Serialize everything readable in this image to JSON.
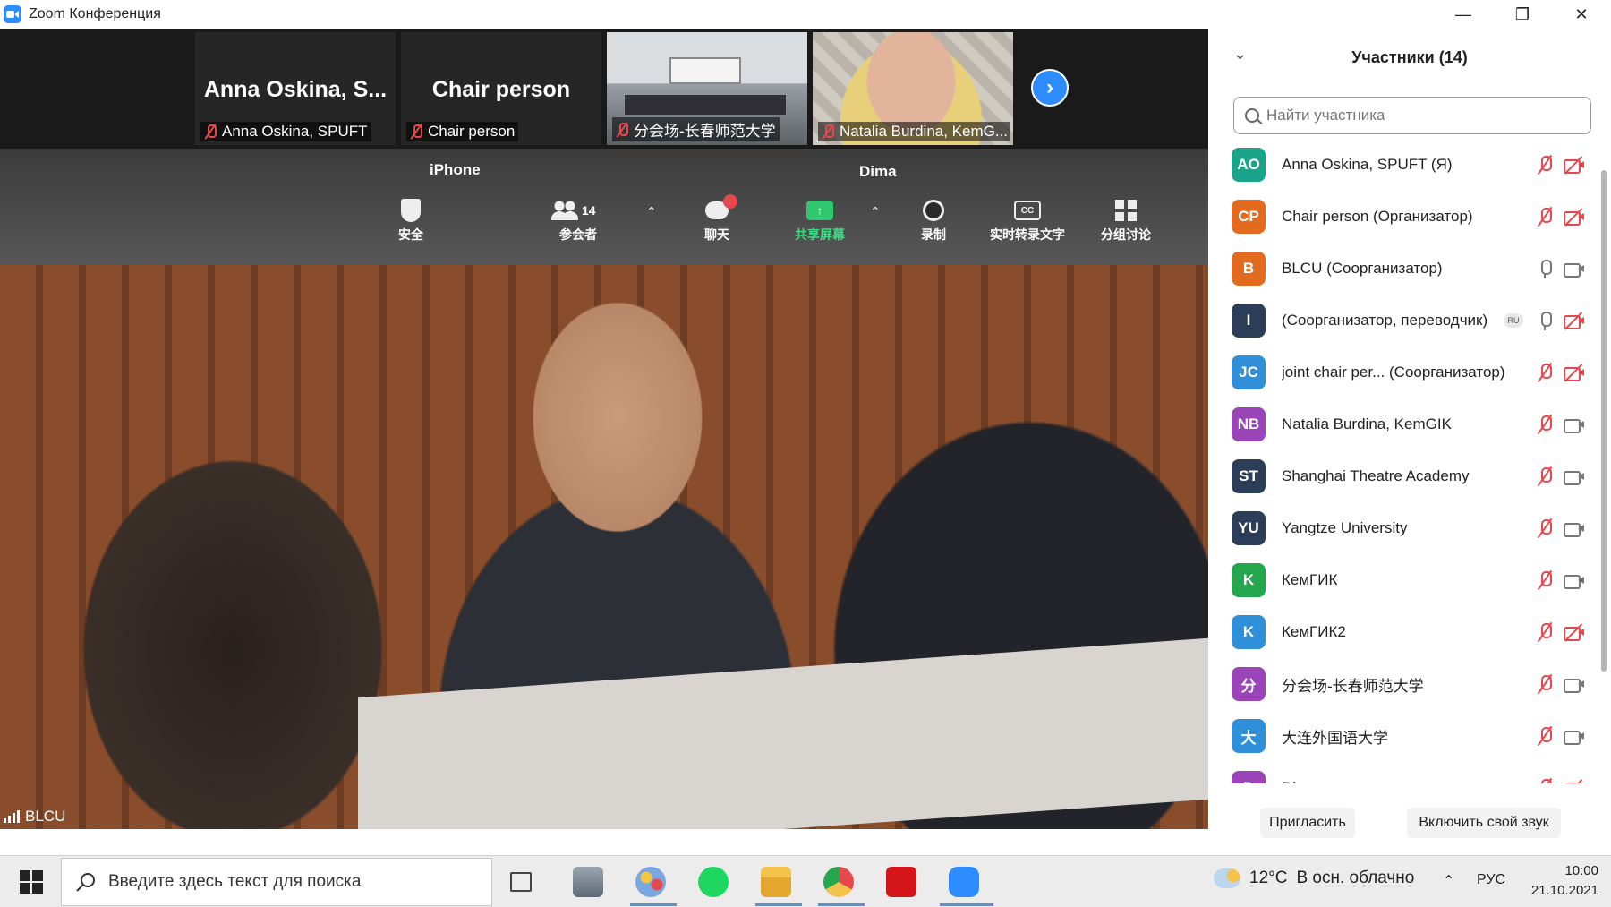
{
  "window": {
    "title": "Zoom Конференция",
    "minimize": "—",
    "restore": "❐",
    "close": "✕"
  },
  "strip": {
    "tiles": [
      {
        "big_name": "Anna  Oskina, S...",
        "label": "Anna Oskina, SPUFT"
      },
      {
        "big_name": "Chair person",
        "label": "Chair person"
      },
      {
        "big_name": "",
        "label": "分会场-长春师范大学"
      },
      {
        "big_name": "",
        "label": "Natalia Burdina, KemG..."
      }
    ],
    "next_icon": "chevron-right-icon"
  },
  "overlay": {
    "left_name": "iPhone",
    "right_name": "Dima"
  },
  "meeting_toolbar": {
    "security": "安全",
    "participants": "参会者",
    "participants_count": "14",
    "chat": "聊天",
    "share": "共享屏幕",
    "record": "录制",
    "captions": "实时转录文字",
    "breakout": "分组讨论",
    "cc": "CC"
  },
  "speaker": {
    "name": "BLCU"
  },
  "panel": {
    "title": "Участники (14)",
    "search_placeholder": "Найти участника",
    "participants": [
      {
        "initials": "AO",
        "name": "Anna Oskina, SPUFT (Я)",
        "color": "#1aa58a",
        "mic": "off",
        "cam": "off"
      },
      {
        "initials": "CP",
        "name": "Chair person (Организатор)",
        "color": "#e36b1f",
        "mic": "off",
        "cam": "off"
      },
      {
        "initials": "B",
        "name": "BLCU (Соорганизатор)",
        "color": "#e36b1f",
        "mic": "on",
        "cam": "on"
      },
      {
        "initials": "I",
        "name": "(Соорганизатор, переводчик)",
        "color": "#2c3e57",
        "mic": "on",
        "cam": "off",
        "badge": "RU"
      },
      {
        "initials": "JC",
        "name": "joint chair per... (Соорганизатор)",
        "color": "#2f8fd8",
        "mic": "off",
        "cam": "off"
      },
      {
        "initials": "NB",
        "name": "Natalia Burdina, KemGIK",
        "color": "#9a44b8",
        "mic": "off",
        "cam": "on"
      },
      {
        "initials": "ST",
        "name": "Shanghai Theatre Academy",
        "color": "#2c3e57",
        "mic": "off",
        "cam": "on"
      },
      {
        "initials": "YU",
        "name": "Yangtze University",
        "color": "#2c3e57",
        "mic": "off",
        "cam": "on"
      },
      {
        "initials": "K",
        "name": "КемГИК",
        "color": "#24a64d",
        "mic": "off",
        "cam": "on"
      },
      {
        "initials": "K",
        "name": "КемГИК2",
        "color": "#2f8fd8",
        "mic": "off",
        "cam": "off"
      },
      {
        "initials": "分",
        "name": "分会场-长春师范大学",
        "color": "#9a44b8",
        "mic": "off",
        "cam": "on"
      },
      {
        "initials": "大",
        "name": "大连外国语大学",
        "color": "#2f8fd8",
        "mic": "off",
        "cam": "on"
      },
      {
        "initials": "D",
        "name": "Di...",
        "color": "#9a44b8",
        "mic": "off",
        "cam": "off"
      }
    ],
    "invite_button": "Пригласить",
    "unmute_button": "Включить свой звук"
  },
  "taskbar": {
    "search_placeholder": "Введите здесь текст для поиска",
    "weather_temp": "12°C",
    "weather_text": "В осн. облачно",
    "language": "РУС",
    "time": "10:00",
    "date": "21.10.2021"
  }
}
